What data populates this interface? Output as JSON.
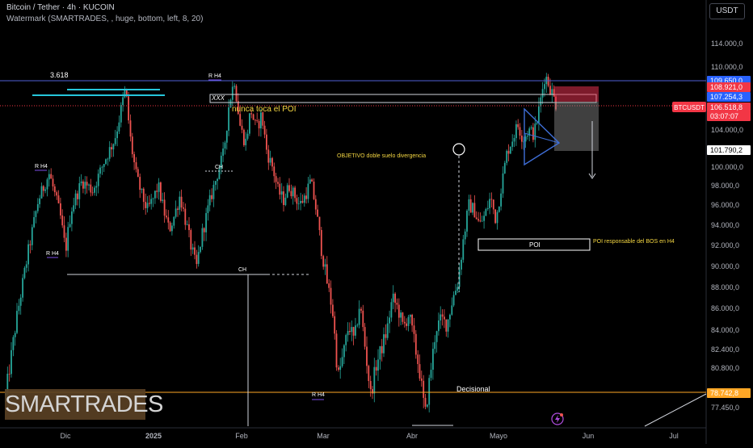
{
  "header": {
    "title_line": "Bitcoin / Tether · 4h · KUCOIN",
    "indicator_line": "Watermark (SMARTRADES, , huge, bottom, left, 8, 20)",
    "currency_button": "USDT"
  },
  "watermark_text": "SMARTRADES",
  "colors": {
    "background": "#000000",
    "up_candle": "#26a69a",
    "down_candle": "#ef5350",
    "annotation_yellow": "#f5d742",
    "fib_line": "#26c6da",
    "pattern_blue": "#3f6fd8",
    "short_zone_red": "#e3314f",
    "stop_zone_gray": "#8e8e8e",
    "price_red": "#f23645",
    "price_blue": "#2962ff",
    "level_orange": "#ffa726"
  },
  "chart_data": {
    "type": "candlestick",
    "symbol": "BTCUSDT",
    "timeframe": "4h",
    "exchange": "KUCOIN",
    "y_axis_ticks": [
      "114.000,0",
      "110.000,0",
      "104.000,0",
      "100.000,0",
      "98.000,0",
      "96.000,0",
      "94.000,0",
      "92.000,0",
      "90.000,0",
      "88.000,0",
      "86.000,0",
      "84.000,0",
      "82.400,0",
      "80.800,0",
      "77.450,0"
    ],
    "x_axis_ticks": [
      "Dic",
      "2025",
      "Feb",
      "Mar",
      "Abr",
      "Mayo",
      "Jun",
      "Jul"
    ],
    "price_labels": [
      {
        "text": "109.650,0",
        "kind": "blue"
      },
      {
        "text": "108.921,0",
        "kind": "red"
      },
      {
        "text": "107.254,3",
        "kind": "blue"
      },
      {
        "text": "106.518,8",
        "kind": "red"
      },
      {
        "text": "03:07:07",
        "kind": "red"
      },
      {
        "text": "101.790,2",
        "kind": "white"
      },
      {
        "text": "78.742,8",
        "kind": "orange"
      }
    ],
    "last_price_label": "BTCUSDT",
    "annotations": {
      "fib_label": "3.618",
      "rh4_top": "R H4",
      "rh4_left": "R H4",
      "rh4_left_low": "R H4",
      "rh4_bottom": "R H4",
      "xxx": "XXX",
      "nunca_toca": "nunca toca el POI",
      "objetivo": "OBJETIVO doble suelo divergencia",
      "ch_upper": "CH",
      "ch_lower": "CH",
      "poi_box": "POI",
      "poi_note": "POI responsable del BOS en H4",
      "decisional": "Decisional"
    },
    "price_path": [
      [
        0,
        78500
      ],
      [
        2,
        85000
      ],
      [
        4,
        91000
      ],
      [
        6,
        96500
      ],
      [
        8,
        99300
      ],
      [
        10,
        95000
      ],
      [
        11,
        91500
      ],
      [
        12,
        95500
      ],
      [
        14,
        98500
      ],
      [
        16,
        97500
      ],
      [
        18,
        100500
      ],
      [
        20,
        103000
      ],
      [
        21,
        105500
      ],
      [
        22,
        108000
      ],
      [
        23,
        102500
      ],
      [
        24,
        99000
      ],
      [
        25,
        97000
      ],
      [
        26,
        95500
      ],
      [
        27,
        96500
      ],
      [
        28,
        98000
      ],
      [
        29,
        95500
      ],
      [
        30,
        93500
      ],
      [
        31,
        95000
      ],
      [
        32,
        97000
      ],
      [
        33,
        94500
      ],
      [
        34,
        92000
      ],
      [
        35,
        89800
      ],
      [
        36,
        93000
      ],
      [
        38,
        97500
      ],
      [
        40,
        101500
      ],
      [
        41,
        106500
      ],
      [
        42,
        108800
      ],
      [
        43,
        104500
      ],
      [
        44,
        102500
      ],
      [
        45,
        106000
      ],
      [
        46,
        104000
      ],
      [
        47,
        105500
      ],
      [
        48,
        101500
      ],
      [
        49,
        100000
      ],
      [
        50,
        97500
      ],
      [
        51,
        96500
      ],
      [
        52,
        98000
      ],
      [
        53,
        97000
      ],
      [
        54,
        96000
      ],
      [
        55,
        97000
      ],
      [
        56,
        98500
      ],
      [
        57,
        95500
      ],
      [
        58,
        91500
      ],
      [
        59,
        88500
      ],
      [
        60,
        85800
      ],
      [
        61,
        80000
      ],
      [
        62,
        82000
      ],
      [
        63,
        84500
      ],
      [
        64,
        83000
      ],
      [
        65,
        86500
      ],
      [
        66,
        82500
      ],
      [
        67,
        78500
      ],
      [
        68,
        81000
      ],
      [
        69,
        82500
      ],
      [
        70,
        84000
      ],
      [
        71,
        87000
      ],
      [
        72,
        86000
      ],
      [
        73,
        84200
      ],
      [
        74,
        85500
      ],
      [
        75,
        83000
      ],
      [
        76,
        80500
      ],
      [
        77,
        76800
      ],
      [
        78,
        80500
      ],
      [
        79,
        84200
      ],
      [
        80,
        85000
      ],
      [
        81,
        84500
      ],
      [
        82,
        86800
      ],
      [
        83,
        88500
      ],
      [
        84,
        92500
      ],
      [
        85,
        96000
      ],
      [
        86,
        95500
      ],
      [
        87,
        94000
      ],
      [
        88,
        95000
      ],
      [
        89,
        96800
      ],
      [
        90,
        94500
      ],
      [
        91,
        98000
      ],
      [
        92,
        101500
      ],
      [
        93,
        103000
      ],
      [
        94,
        104500
      ],
      [
        95,
        103000
      ],
      [
        96,
        104000
      ],
      [
        97,
        103500
      ],
      [
        98,
        106200
      ],
      [
        99,
        109300
      ],
      [
        100,
        108000
      ],
      [
        101,
        106500
      ]
    ],
    "candle_count": 292
  }
}
